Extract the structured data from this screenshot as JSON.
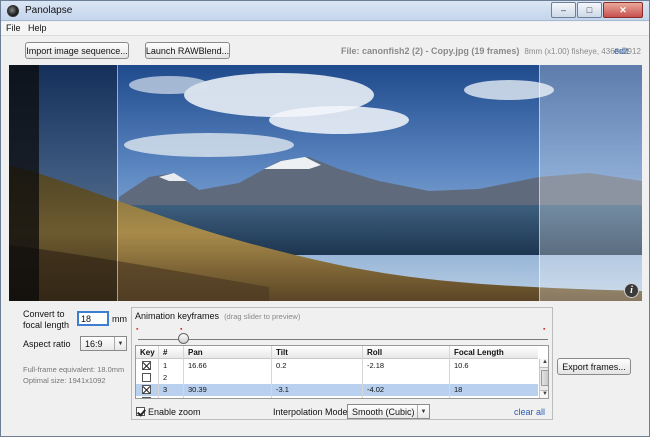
{
  "window": {
    "title": "Panolapse",
    "minimize_glyph": "–",
    "maximize_glyph": "□",
    "close_glyph": "✕"
  },
  "menu": {
    "file": "File",
    "help": "Help"
  },
  "toolbar": {
    "import_label": "Import image sequence...",
    "rawblend_label": "Launch RAWBlend...",
    "file_label": "File: canonfish2 (2) - Copy.jpg (19 frames)",
    "file_meta": "8mm (x1.00) fisheye, 4368x2912",
    "edit_label": "edit"
  },
  "preview": {
    "info_icon": "i"
  },
  "settings": {
    "convert_label_line1": "Convert to",
    "convert_label_line2": "focal length",
    "focal_value": "18",
    "focal_unit": "mm",
    "aspect_label": "Aspect ratio",
    "aspect_value": "16:9",
    "fullframe_text": "Full-frame equivalent: 18.0mm",
    "optimal_text": "Optimal size: 1941x1092"
  },
  "keyframes": {
    "title": "Animation keyframes",
    "hint": "(drag slider to preview)",
    "columns": [
      "Key",
      "#",
      "Pan",
      "Tilt",
      "Roll",
      "Focal Length"
    ],
    "rows": [
      {
        "key": true,
        "num": "1",
        "pan": "16.66",
        "tilt": "0.2",
        "roll": "-2.18",
        "focal": "10.6",
        "selected": false
      },
      {
        "key": false,
        "num": "2",
        "pan": "",
        "tilt": "",
        "roll": "",
        "focal": "",
        "selected": false
      },
      {
        "key": true,
        "num": "3",
        "pan": "30.39",
        "tilt": "-3.1",
        "roll": "-4.02",
        "focal": "18",
        "selected": true
      },
      {
        "key": false,
        "num": "4",
        "pan": "",
        "tilt": "",
        "roll": "",
        "focal": "",
        "selected": false
      }
    ],
    "enable_zoom_label": "Enable zoom",
    "enable_zoom_checked": true,
    "interpolation_label": "Interpolation Mode:",
    "interpolation_value": "Smooth (Cubic)",
    "clear_all_label": "clear all"
  },
  "export": {
    "label": "Export frames..."
  }
}
